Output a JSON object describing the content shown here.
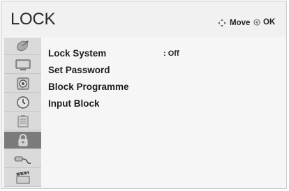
{
  "header": {
    "title": "LOCK",
    "move_label": "Move",
    "ok_label": "OK"
  },
  "sidebar": {
    "items": [
      {
        "icon": "satellite-dish-icon",
        "active": false
      },
      {
        "icon": "tv-screen-icon",
        "active": false
      },
      {
        "icon": "speaker-icon",
        "active": false
      },
      {
        "icon": "clock-icon",
        "active": false
      },
      {
        "icon": "settings-options-icon",
        "active": false
      },
      {
        "icon": "lock-icon",
        "active": true
      },
      {
        "icon": "input-cable-icon",
        "active": false
      },
      {
        "icon": "clapperboard-icon",
        "active": false
      }
    ]
  },
  "menu": {
    "items": [
      {
        "label": "Lock System",
        "value": ": Off"
      },
      {
        "label": "Set Password"
      },
      {
        "label": "Block Programme"
      },
      {
        "label": "Input Block"
      }
    ]
  },
  "colors": {
    "active_item": "#7b7b7b",
    "sidebar_bg": "#dadada",
    "panel_bg": "#f6f6f6"
  }
}
